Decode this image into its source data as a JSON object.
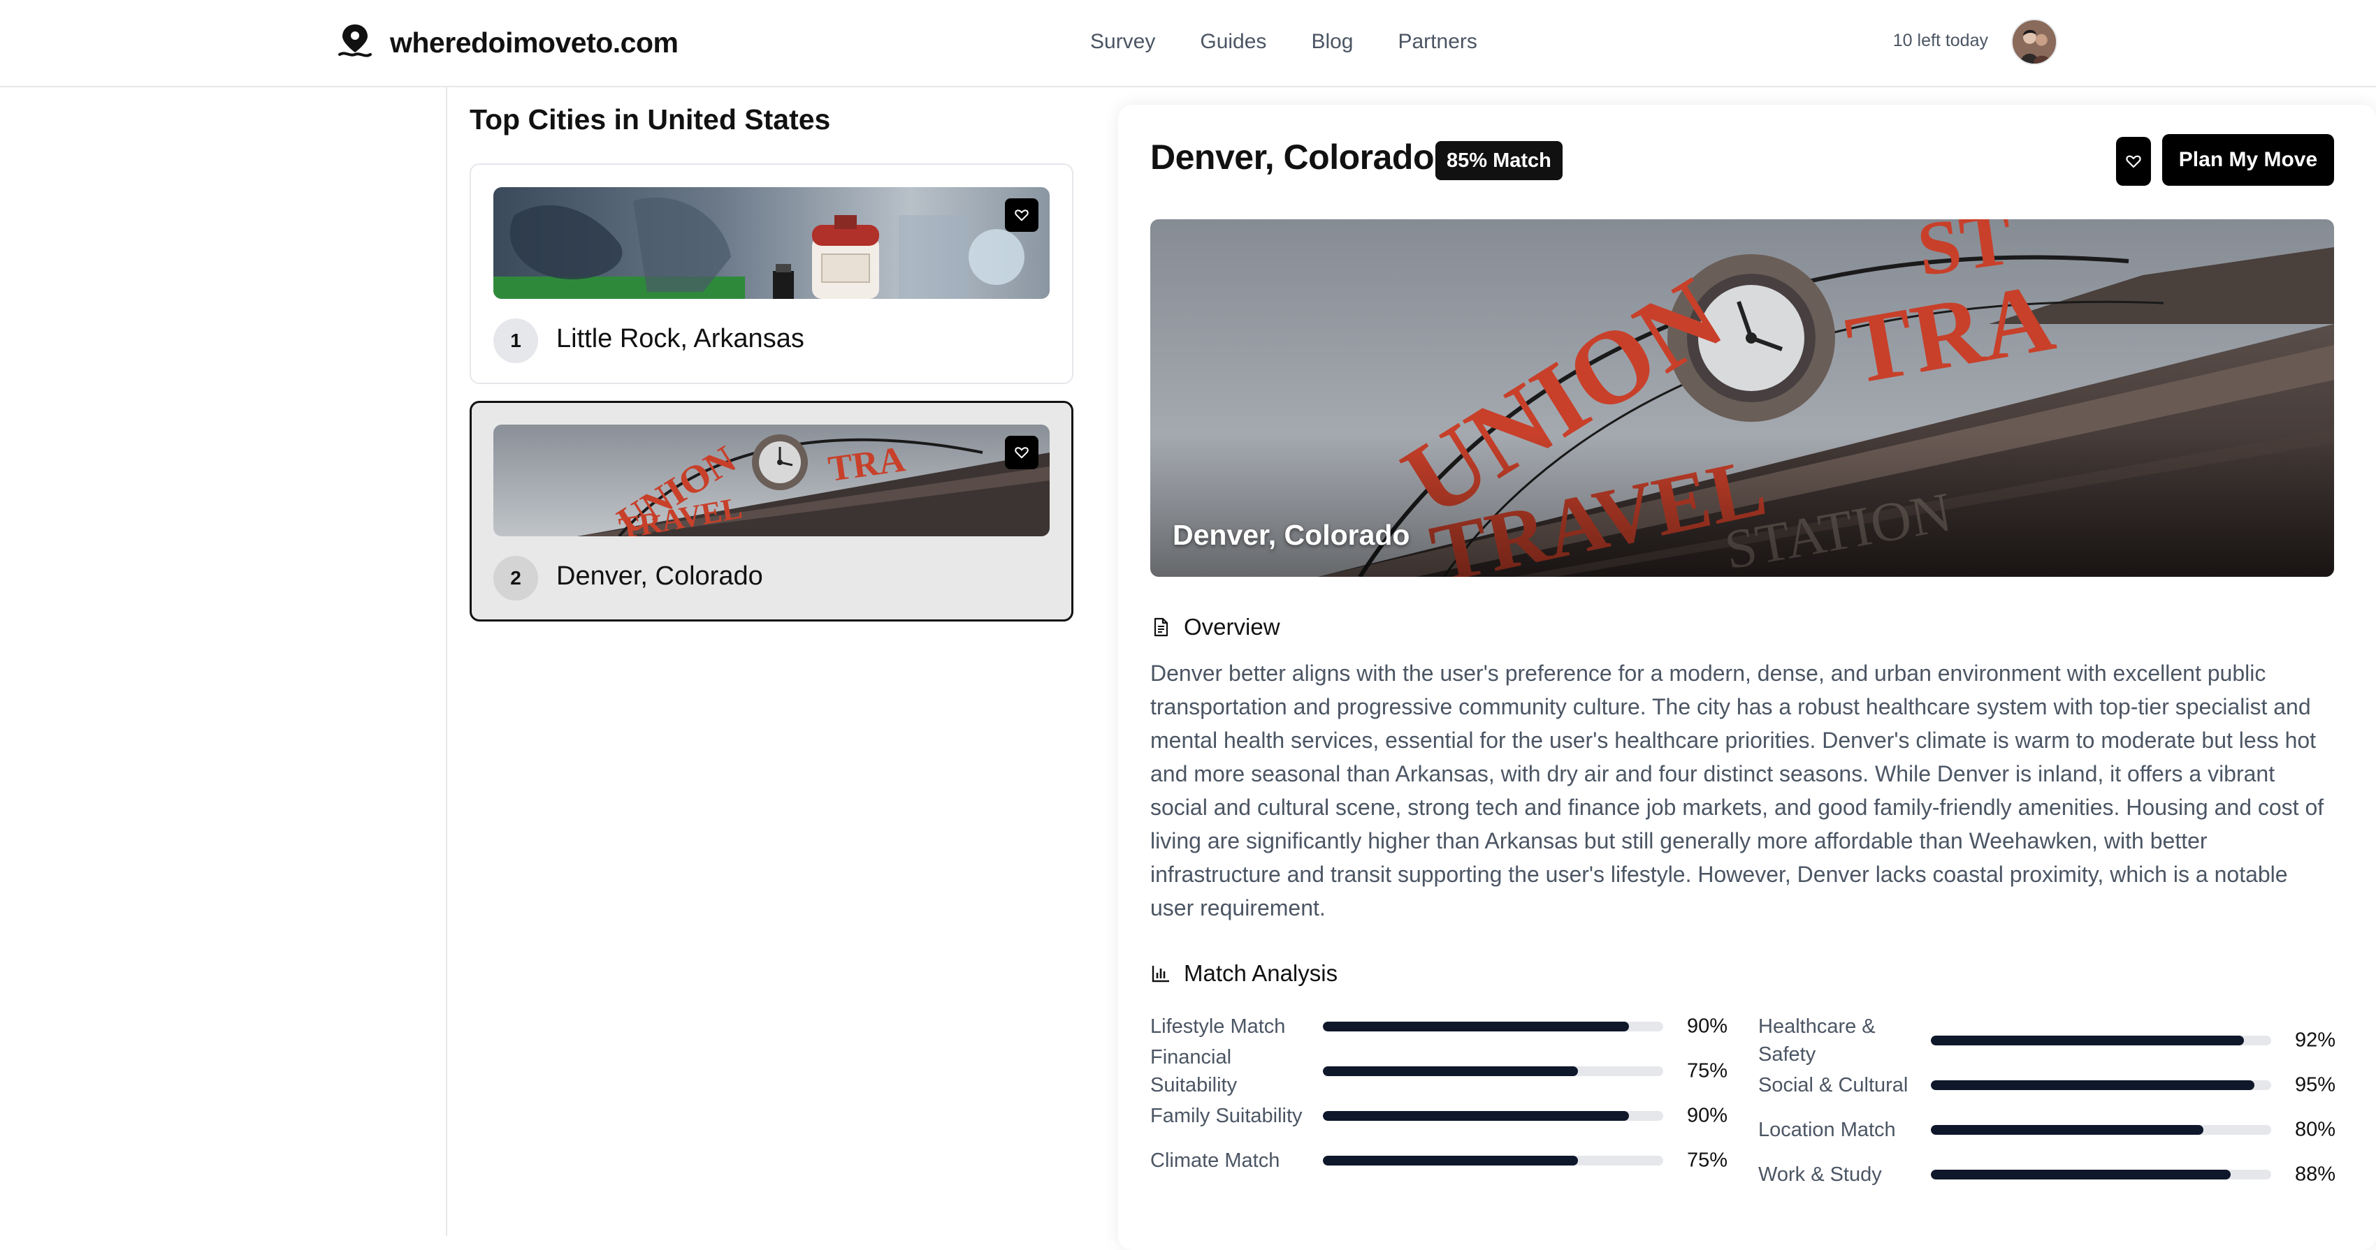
{
  "header": {
    "brand": "wheredoimoveto.com",
    "nav": [
      "Survey",
      "Guides",
      "Blog",
      "Partners"
    ],
    "remaining": "10 left today"
  },
  "city_list": {
    "title": "Top Cities in United States",
    "cities": [
      {
        "rank": "1",
        "name": "Little Rock, Arkansas",
        "selected": false
      },
      {
        "rank": "2",
        "name": "Denver, Colorado",
        "selected": true
      }
    ]
  },
  "detail": {
    "title": "Denver, Colorado",
    "match_badge": "85% Match",
    "plan_button": "Plan My Move",
    "hero_caption": "Denver, Colorado",
    "overview_title": "Overview",
    "overview_text": "Denver better aligns with the user's preference for a modern, dense, and urban environment with excellent public transportation and progressive community culture. The city has a robust healthcare system with top-tier specialist and mental health services, essential for the user's healthcare priorities. Denver's climate is warm to moderate but less hot and more seasonal than Arkansas, with dry air and four distinct seasons. While Denver is inland, it offers a vibrant social and cultural scene, strong tech and finance job markets, and good family-friendly amenities. Housing and cost of living are significantly higher than Arkansas but still generally more affordable than Weehawken, with better infrastructure and transit supporting the user's lifestyle. However, Denver lacks coastal proximity, which is a notable user requirement.",
    "analysis_title": "Match Analysis",
    "metrics_left": [
      {
        "label": "Lifestyle Match",
        "pct": "90%",
        "value": 90
      },
      {
        "label": "Financial Suitability",
        "pct": "75%",
        "value": 75
      },
      {
        "label": "Family Suitability",
        "pct": "90%",
        "value": 90
      },
      {
        "label": "Climate Match",
        "pct": "75%",
        "value": 75
      }
    ],
    "metrics_right": [
      {
        "label": "Healthcare & Safety",
        "pct": "92%",
        "value": 92
      },
      {
        "label": "Social & Cultural",
        "pct": "95%",
        "value": 95
      },
      {
        "label": "Location Match",
        "pct": "80%",
        "value": 80
      },
      {
        "label": "Work & Study",
        "pct": "88%",
        "value": 88
      }
    ]
  },
  "icons": {
    "brand": "location-pin-icon",
    "favorite": "heart-icon",
    "overview": "document-icon",
    "analysis": "bar-chart-icon"
  },
  "colors": {
    "accent": "#000000",
    "bar_fill": "#0f172a",
    "bar_track": "#e5e7eb",
    "text_muted": "#4b5563"
  }
}
